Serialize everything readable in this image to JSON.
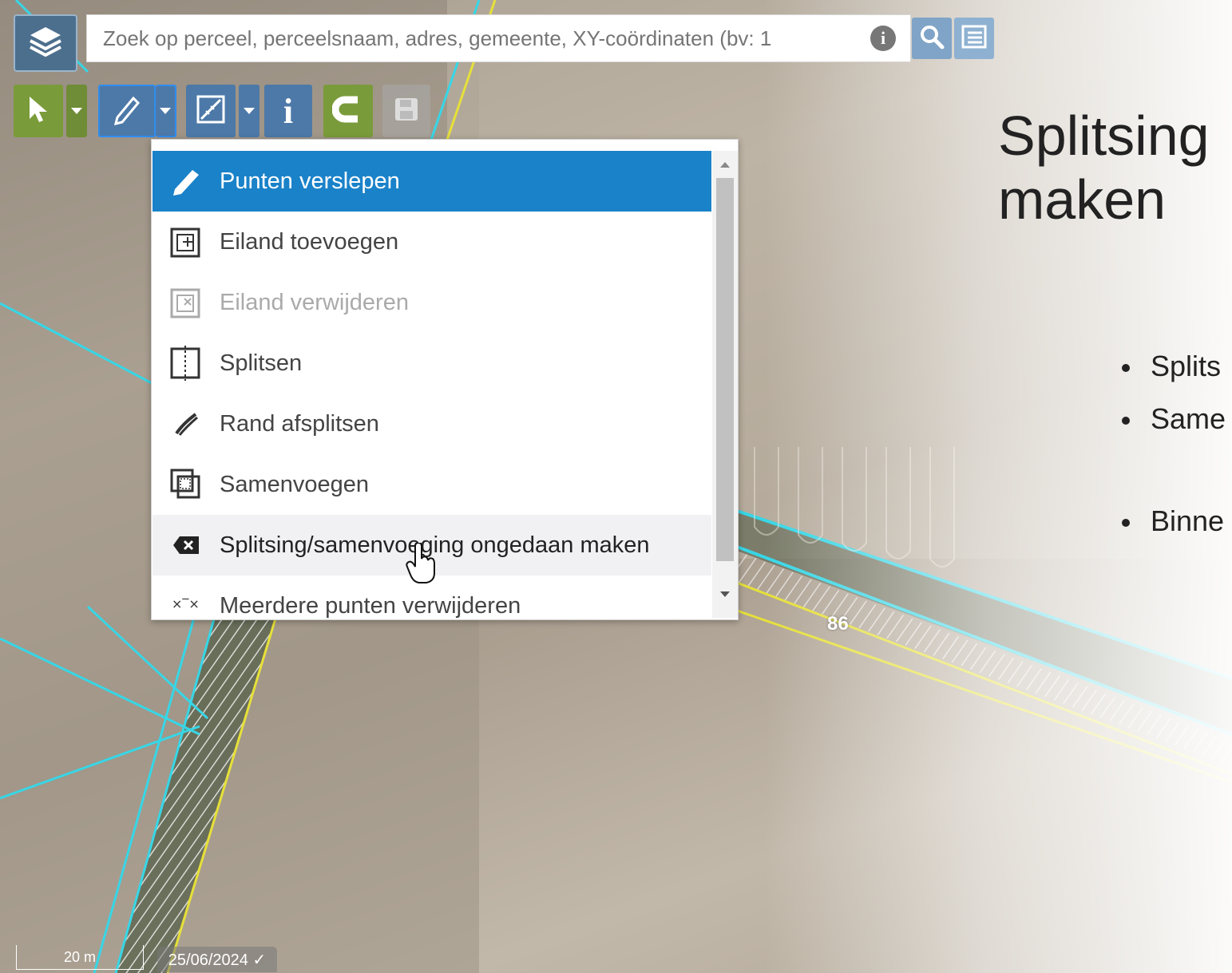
{
  "search": {
    "placeholder": "Zoek op perceel, perceelsnaam, adres, gemeente, XY-coördinaten (bv: 1"
  },
  "toolbar": {
    "icons": [
      "layers-icon",
      "pointer-icon",
      "pencil-icon",
      "measure-icon",
      "info-icon",
      "magnet-icon",
      "save-icon"
    ]
  },
  "dropdown": {
    "items": [
      {
        "label": "Punten verslepen",
        "icon": "pencil-icon",
        "state": "active"
      },
      {
        "label": "Eiland toevoegen",
        "icon": "add-island-icon",
        "state": "normal"
      },
      {
        "label": "Eiland verwijderen",
        "icon": "remove-island-icon",
        "state": "disabled"
      },
      {
        "label": "Splitsen",
        "icon": "split-icon",
        "state": "normal"
      },
      {
        "label": "Rand afsplitsen",
        "icon": "edge-split-icon",
        "state": "normal"
      },
      {
        "label": "Samenvoegen",
        "icon": "merge-icon",
        "state": "normal"
      },
      {
        "label": "Splitsing/samenvoeging ongedaan maken",
        "icon": "undo-split-icon",
        "state": "hover"
      },
      {
        "label": "Meerdere punten verwijderen",
        "icon": "delete-points-icon",
        "state": "normal"
      }
    ]
  },
  "slide": {
    "title_line1": "Splitsing",
    "title_line2": "maken",
    "bullets": [
      "Splits",
      "Same",
      "Binne"
    ]
  },
  "map": {
    "parcel_label": "86",
    "scale_text": "20 m",
    "date_text": "25/06/2024 ✓"
  },
  "colors": {
    "accent": "#1a82c9",
    "toolbar_green": "#7a9b3a",
    "toolbar_blue": "#4d79a8",
    "parcel_cyan": "#37d6e6",
    "parcel_yellow": "#e6e03a"
  }
}
